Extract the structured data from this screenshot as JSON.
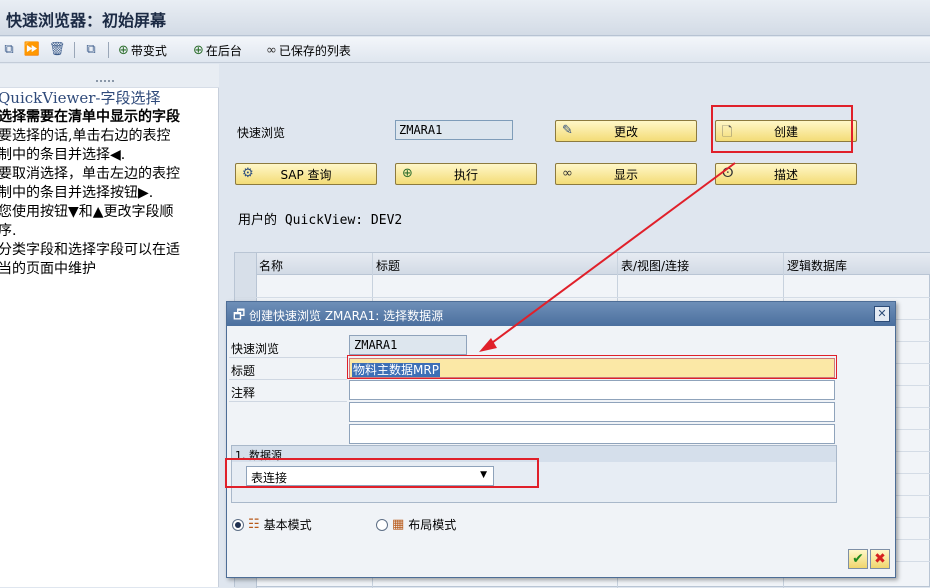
{
  "window": {
    "title": "快速浏览器：初始屏幕"
  },
  "toolbar": {
    "with_variant": "带变式",
    "background": "在后台",
    "saved_lists": "已保存的列表"
  },
  "help": {
    "title_a": "QuickViewer-",
    "title_b": "字段选择",
    "lines": [
      "选择需要在清单中显示的字段",
      "要选择的话,单击右边的表控",
      "制中的条目并选择◀.",
      "要取消选择，单击左边的表控",
      "制中的条目并选择按钮▶.",
      "您使用按钮▼和▲更改字段顺",
      "序.",
      "分类字段和选择字段可以在适",
      "当的页面中维护"
    ]
  },
  "main": {
    "quickview_label": "快速浏览",
    "quickview_value": "ZMARA1",
    "buttons": {
      "change": "更改",
      "create": "创建",
      "sap_query": "SAP 查询",
      "execute": "执行",
      "display": "显示",
      "describe": "描述"
    },
    "user_quickview_label": "用户的",
    "user_quickview_value": "QuickView: DEV2",
    "table": {
      "columns": [
        "名称",
        "标题",
        "表/视图/连接",
        "逻辑数据库"
      ]
    }
  },
  "dialog": {
    "title": "创建快速浏览 ZMARA1: 选择数据源",
    "labels": {
      "quickview": "快速浏览",
      "title": "标题",
      "note": "注释"
    },
    "quickview_value": "ZMARA1",
    "title_value": "物料主数据MRP",
    "group_header": "1. 数据源",
    "datasource_value": "表连接",
    "radio_basic": "基本模式",
    "radio_layout": "布局模式",
    "ok": "✔",
    "cancel": "✖"
  },
  "colors": {
    "annotation_red": "#e0202a",
    "button_yellow": "#f3dc77",
    "dialog_title_blue": "#4b6f9e"
  }
}
